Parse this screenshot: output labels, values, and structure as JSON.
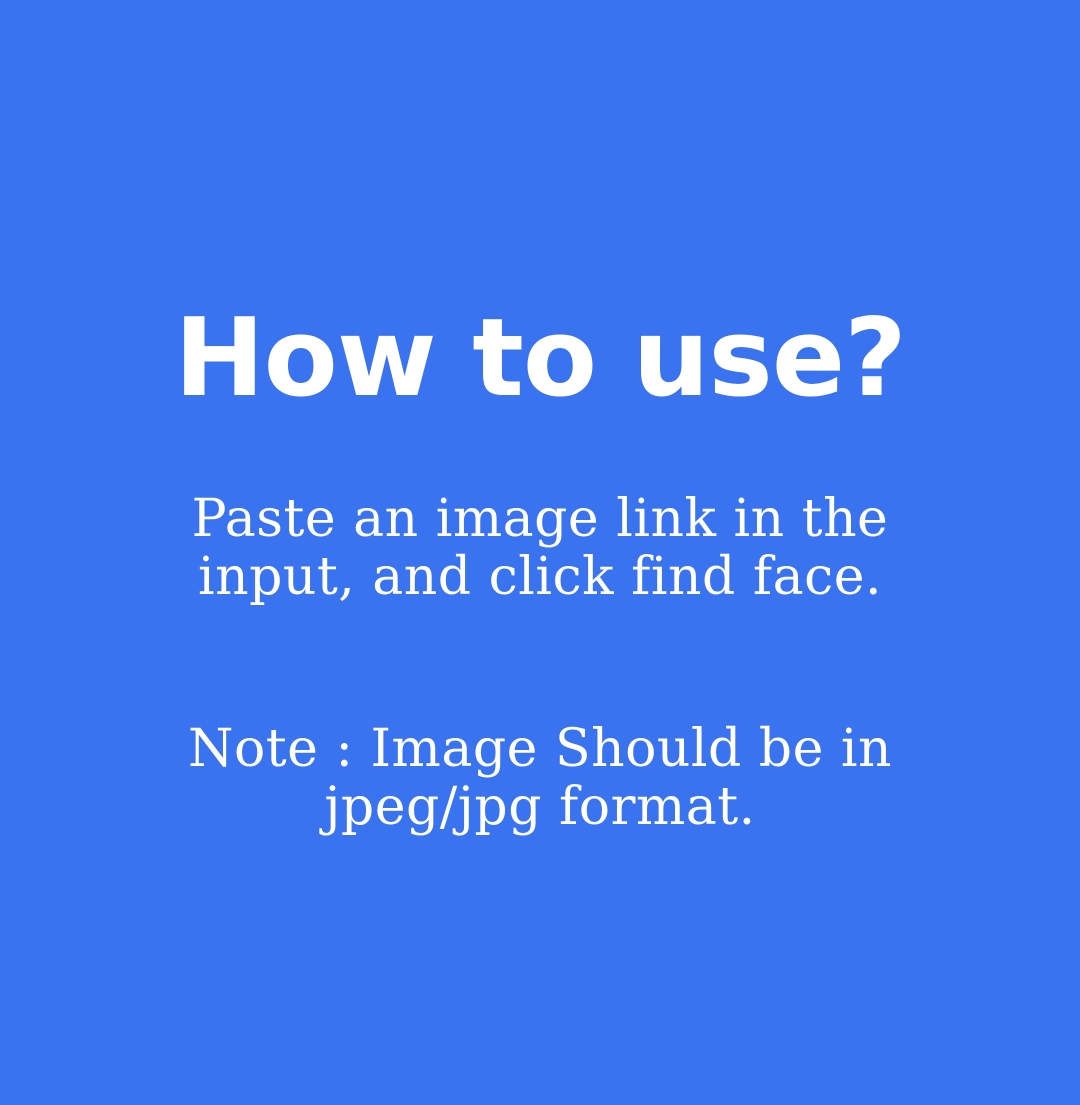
{
  "background_color": "#3a73ef",
  "text_color": "#ffffff",
  "title": "How to use?",
  "instruction": {
    "line_1": "Paste an image link in the",
    "line_2": "input, and click find face."
  },
  "note": {
    "line_1": "Note : Image Should be in",
    "line_2": "jpeg/jpg format."
  }
}
